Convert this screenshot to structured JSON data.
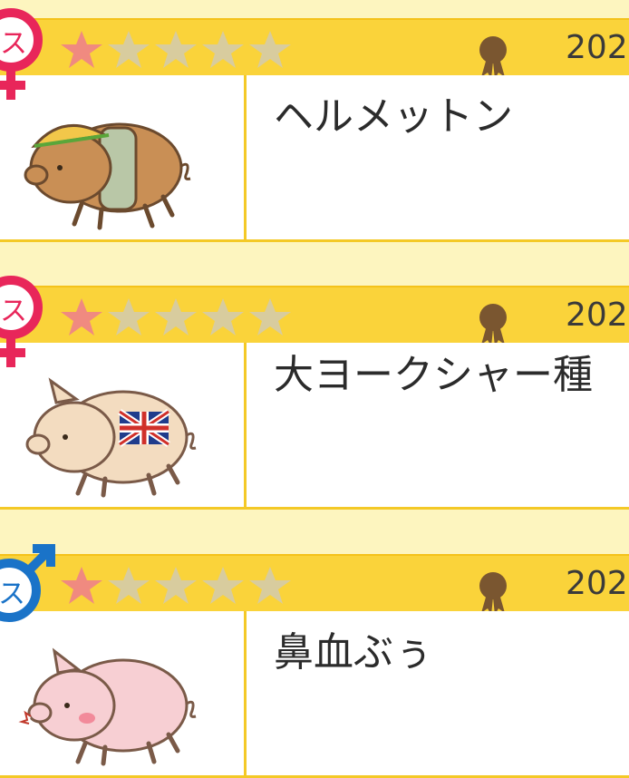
{
  "cards": [
    {
      "name": "ヘルメットン",
      "year": "202",
      "rating": 1,
      "max_rating": 5,
      "gender": "female",
      "gender_icon": "female-symbol-icon",
      "gender_color": "#e8265a",
      "pig_icon": "pig-with-helmet-icon"
    },
    {
      "name": "大ヨークシャー種",
      "year": "202",
      "rating": 1,
      "max_rating": 5,
      "gender": "female",
      "gender_icon": "female-symbol-icon",
      "gender_color": "#e8265a",
      "pig_icon": "pig-with-union-jack-icon"
    },
    {
      "name": "鼻血ぶぅ",
      "year": "202",
      "rating": 1,
      "max_rating": 5,
      "gender": "male",
      "gender_icon": "male-symbol-icon",
      "gender_color": "#1a73c8",
      "pig_icon": "pig-with-nosebleed-icon"
    }
  ],
  "colors": {
    "background": "#fdf5bf",
    "header": "#fad33a",
    "star_filled": "#f08a80",
    "star_empty": "#d8cc9e",
    "medal": "#7a5630"
  }
}
